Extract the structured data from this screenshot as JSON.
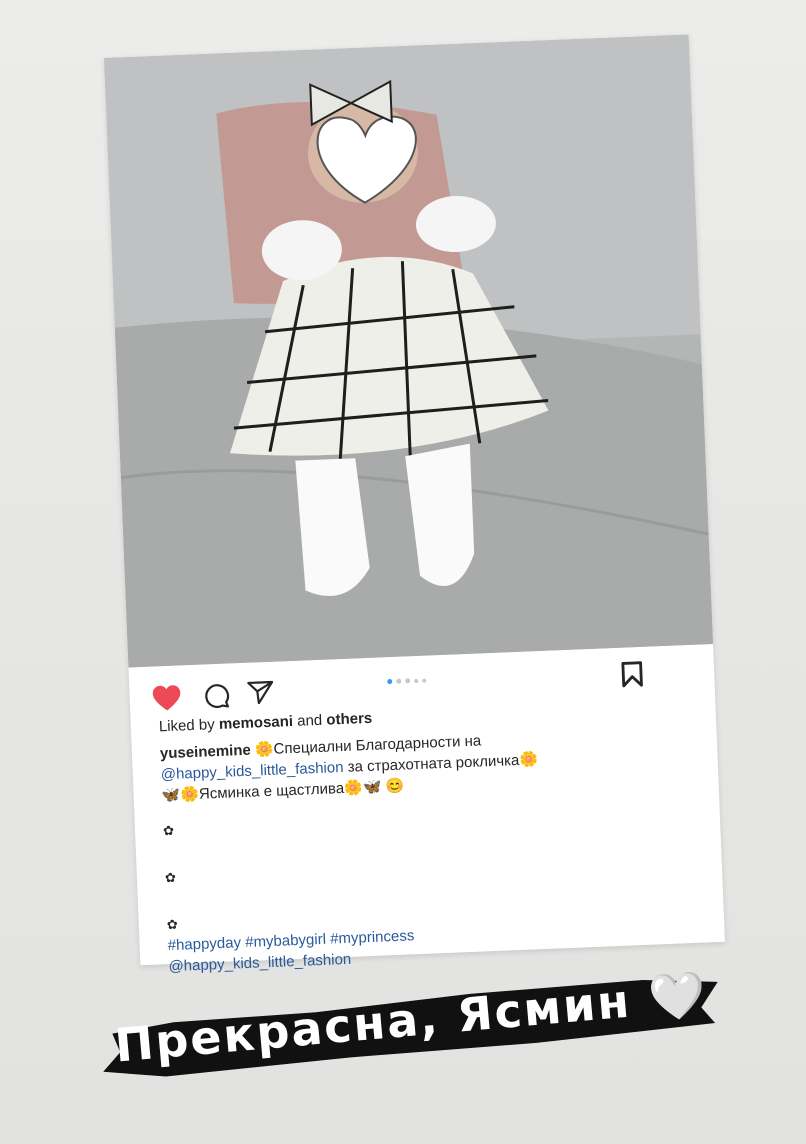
{
  "post": {
    "likes": {
      "prefix": "Liked by ",
      "user": "memosani",
      "middle": " and ",
      "others": "others"
    },
    "caption": {
      "username": "yuseinemine",
      "emoji_flower": "🌼",
      "line1_text": "Специални Благодарности на",
      "mention": "@happy_kids_little_fashion",
      "line2_text": " за страхотната рокличка",
      "emoji_butterfly": "🦋",
      "line3_text": "Ясминка е щастлива",
      "emoji_smile": "😊",
      "bullet": "✿",
      "hashtags": "#happyday #mybabygirl #myprincess",
      "mention2": "@happy_kids_little_fashion"
    },
    "carousel": {
      "total": 5,
      "active": 1
    },
    "icons": [
      "heart-icon",
      "comment-icon",
      "share-icon",
      "bookmark-icon"
    ],
    "colors": {
      "heart": "#ed4956",
      "link": "#2a5a9c",
      "dot_active": "#3897f0"
    }
  },
  "overlay": {
    "caption": "Прекрасна, Ясмин",
    "emoji": "🤍"
  }
}
